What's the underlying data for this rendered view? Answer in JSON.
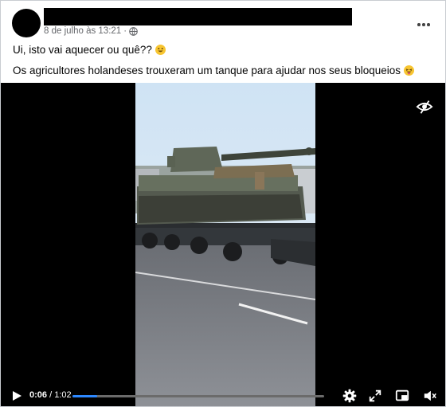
{
  "post": {
    "timestamp": "8 de julho às 13:21",
    "separator": "·",
    "privacy_icon": "globe-icon",
    "more_icon": "more-options-icon",
    "line1": "Ui, isto vai aquecer ou quê??",
    "line1_emoji": "grinning-face-emoji",
    "line2": "Os agricultores holandeses trouxeram um tanque para ajudar nos seus bloqueios",
    "line2_emoji": "tongue-winking-face-emoji"
  },
  "video": {
    "current_time": "0:06",
    "time_separator": " / ",
    "duration": "1:02",
    "progress": 0.097,
    "hide_icon": "eye-slash-icon",
    "controls_icons": [
      "play-icon",
      "settings-icon",
      "fullscreen-icon",
      "picture-in-picture-icon",
      "volume-icon"
    ],
    "accent_color": "#2d88ff"
  }
}
